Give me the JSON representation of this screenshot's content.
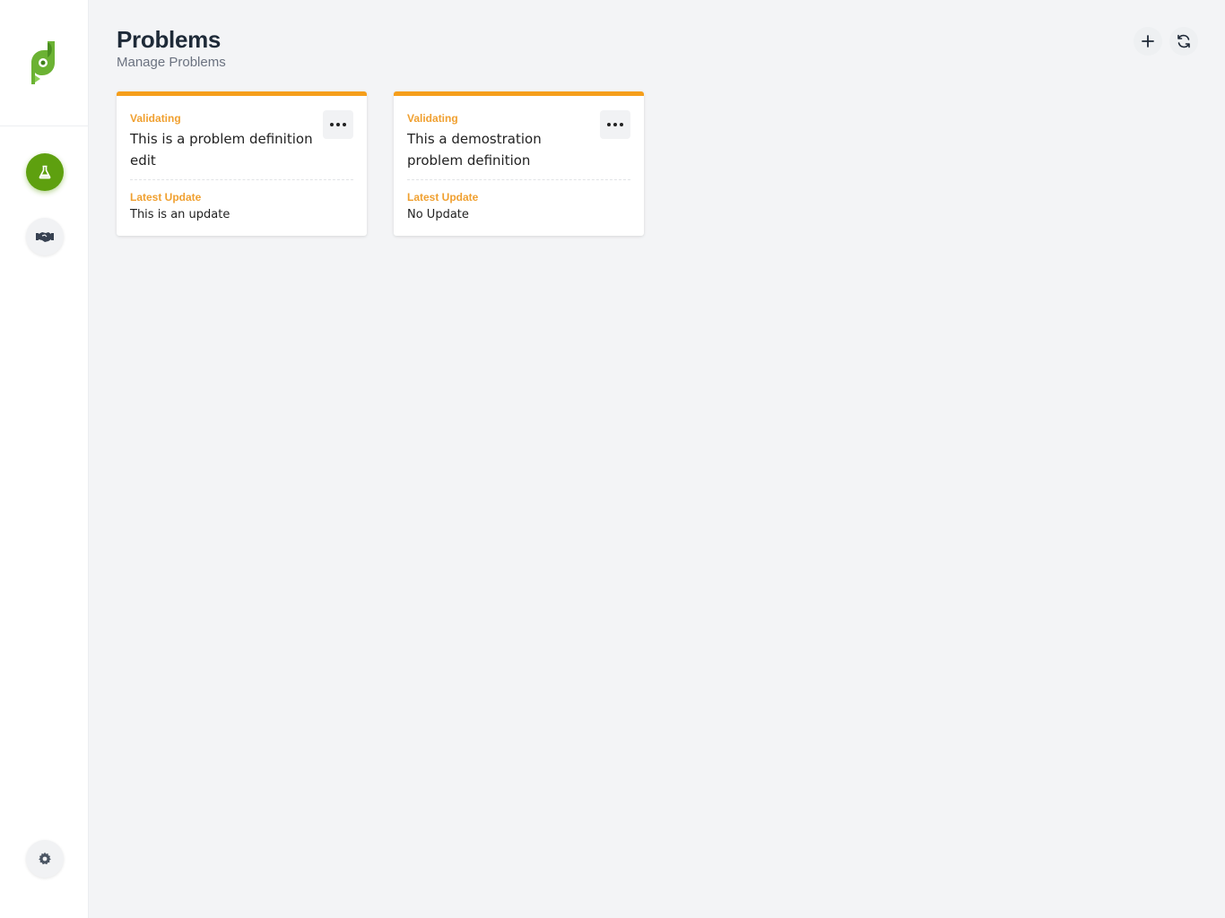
{
  "header": {
    "title": "Problems",
    "subtitle": "Manage Problems"
  },
  "sidebar": {
    "items": [
      {
        "name": "problems",
        "icon": "flask-icon",
        "active": true
      },
      {
        "name": "partners",
        "icon": "handshake-icon",
        "active": false
      }
    ],
    "bottom": {
      "name": "settings",
      "icon": "gear-icon"
    }
  },
  "toolbar": {
    "add_icon": "plus-icon",
    "refresh_icon": "refresh-icon"
  },
  "cards": [
    {
      "status": "Validating",
      "title": "This is a problem definition edit",
      "update_label": "Latest Update",
      "update_text": "This is an update"
    },
    {
      "status": "Validating",
      "title": "This a demostration problem definition",
      "update_label": "Latest Update",
      "update_text": "No Update"
    }
  ],
  "colors": {
    "accent_green": "#5ea00f",
    "status_orange": "#f59e1b",
    "background": "#f3f4f6"
  }
}
